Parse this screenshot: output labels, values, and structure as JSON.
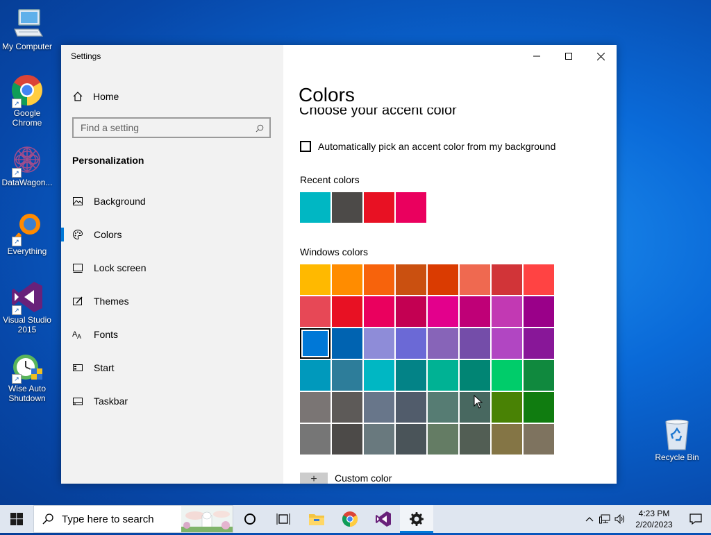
{
  "desktop": {
    "icons": [
      {
        "label": "My Computer",
        "icon": "computer-icon"
      },
      {
        "label": "Google Chrome",
        "icon": "chrome-icon"
      },
      {
        "label": "DataWagon...",
        "icon": "datawagon-icon"
      },
      {
        "label": "Everything",
        "icon": "everything-icon"
      },
      {
        "label": "Visual Studio 2015",
        "icon": "visual-studio-icon"
      },
      {
        "label": "Wise Auto Shutdown",
        "icon": "wise-shutdown-icon"
      },
      {
        "label": "Recycle Bin",
        "icon": "recycle-bin-icon"
      }
    ]
  },
  "window": {
    "title": "Settings",
    "home_label": "Home",
    "search_placeholder": "Find a setting",
    "section_title": "Personalization",
    "nav_items": [
      {
        "label": "Background",
        "icon": "picture-icon"
      },
      {
        "label": "Colors",
        "icon": "palette-icon",
        "active": true
      },
      {
        "label": "Lock screen",
        "icon": "lock-screen-icon"
      },
      {
        "label": "Themes",
        "icon": "themes-icon"
      },
      {
        "label": "Fonts",
        "icon": "fonts-icon"
      },
      {
        "label": "Start",
        "icon": "start-icon"
      },
      {
        "label": "Taskbar",
        "icon": "taskbar-icon"
      }
    ]
  },
  "content": {
    "page_title": "Colors",
    "accent_heading": "Choose your accent color",
    "auto_pick_label": "Automatically pick an accent color from my background",
    "auto_pick_checked": false,
    "recent_label": "Recent colors",
    "recent_colors": [
      "#00b7c3",
      "#4c4a48",
      "#e81123",
      "#ea005e"
    ],
    "windows_label": "Windows colors",
    "windows_colors": [
      "#ffb900",
      "#ff8c00",
      "#f7630c",
      "#ca5010",
      "#da3b01",
      "#ef6950",
      "#d13438",
      "#ff4343",
      "#e74856",
      "#e81123",
      "#ea005e",
      "#c30052",
      "#e3008c",
      "#bf0077",
      "#c239b3",
      "#9a0089",
      "#0078d7",
      "#0063b1",
      "#8e8cd8",
      "#6b69d6",
      "#8764b8",
      "#744da9",
      "#b146c2",
      "#881798",
      "#0099bc",
      "#2d7d9a",
      "#00b7c3",
      "#038387",
      "#00b294",
      "#018574",
      "#00cc6a",
      "#10893e",
      "#7a7574",
      "#5d5a58",
      "#68768a",
      "#515c6b",
      "#567c73",
      "#486860",
      "#498205",
      "#107c10",
      "#767676",
      "#4c4a48",
      "#69797e",
      "#4a5459",
      "#647c64",
      "#525e54",
      "#847545",
      "#7e735f"
    ],
    "selected_color": "#0078d7",
    "custom_label": "Custom color"
  },
  "taskbar": {
    "search_placeholder": "Type here to search",
    "time": "4:23 PM",
    "date": "2/20/2023",
    "pinned": [
      "file-explorer-icon",
      "chrome-icon",
      "visual-studio-icon",
      "settings-icon"
    ]
  }
}
